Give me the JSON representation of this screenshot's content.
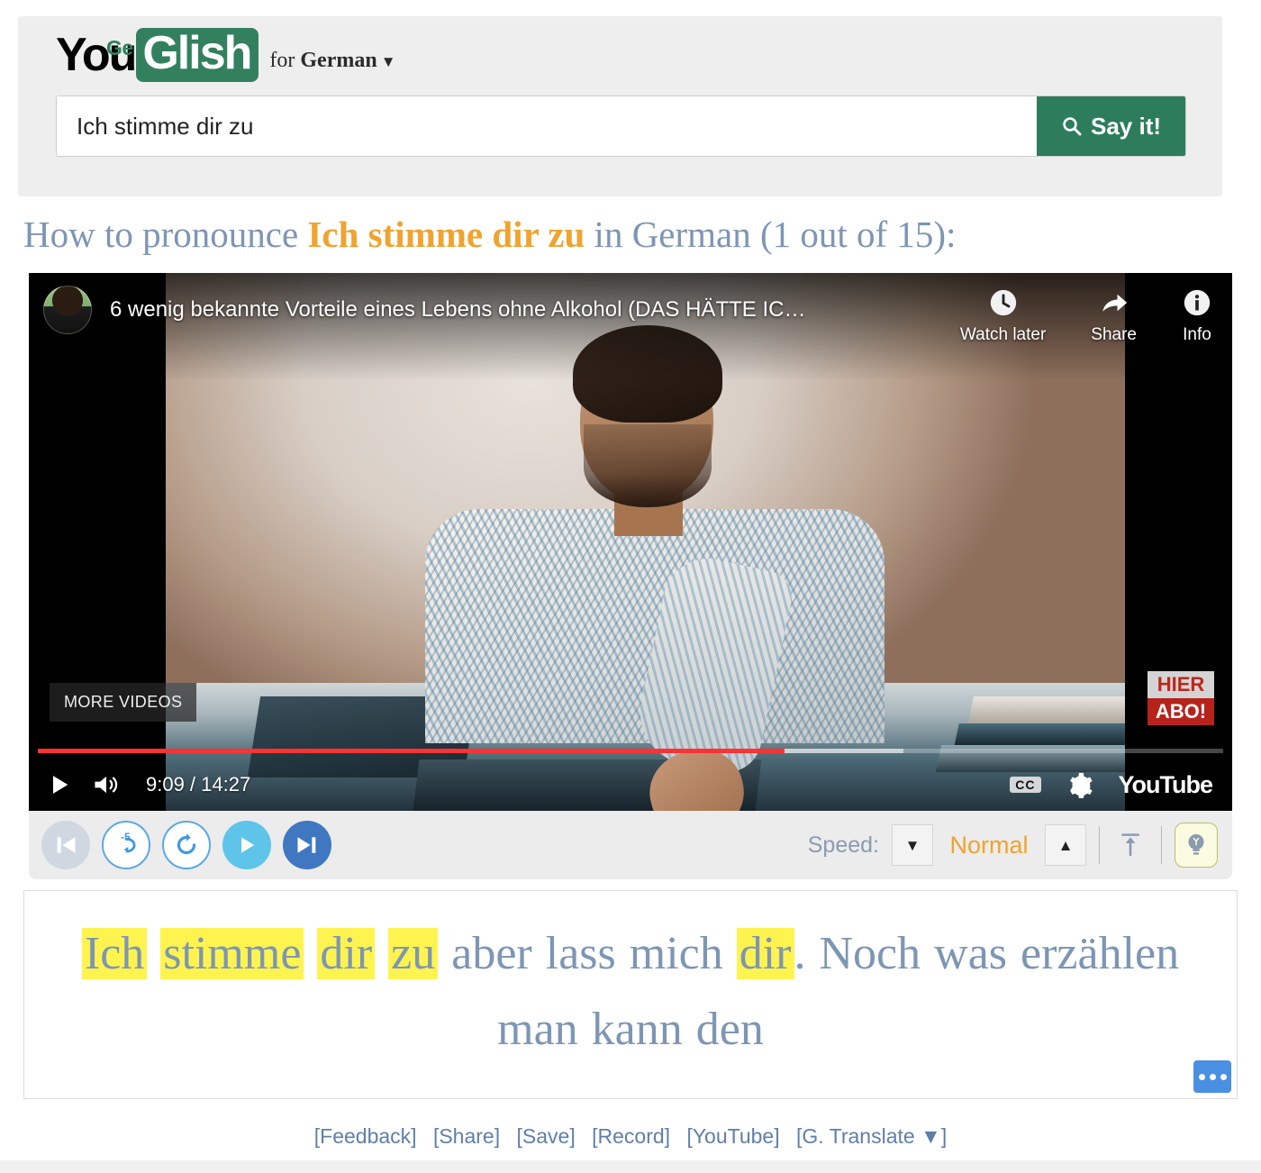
{
  "brand": {
    "logo_you": "You",
    "logo_ge": "Ge",
    "logo_glish": "Glish",
    "for_prefix": "for ",
    "language": "German",
    "language_caret": "▼"
  },
  "search": {
    "value": "Ich stimme dir zu",
    "placeholder": "Ich stimme dir zu",
    "button_label": "Say it!",
    "icon": "search-icon"
  },
  "headline": {
    "prefix": "How to pronounce ",
    "term": "Ich stimme dir zu",
    "suffix": " in German (1 out of 15):"
  },
  "player": {
    "video_title": "6 wenig bekannte Vorteile eines Lebens ohne Alkohol (DAS HÄTTE IC…",
    "avatar": "channel-avatar",
    "actions": [
      {
        "label": "Watch later",
        "icon": "clock-icon"
      },
      {
        "label": "Share",
        "icon": "share-arrow-icon"
      },
      {
        "label": "Info",
        "icon": "info-icon"
      }
    ],
    "more_videos_label": "MORE VIDEOS",
    "abo_badge_top": "HIER",
    "abo_badge_bottom": "ABO!",
    "current_time": "9:09",
    "total_time": "14:27",
    "time_display": "9:09 / 14:27",
    "progress_percent": 63,
    "buffered_percent": 73,
    "cc_label": "CC",
    "youtube_label": "YouTube",
    "play_icon": "play-icon",
    "volume_icon": "volume-icon",
    "settings_icon": "gear-icon"
  },
  "controls": {
    "buttons": [
      {
        "name": "previous-occurrence",
        "icon": "skip-previous-icon",
        "state": "disabled"
      },
      {
        "name": "rewind-5-seconds",
        "icon": "replay-5-icon",
        "label": "-5"
      },
      {
        "name": "replay-occurrence",
        "icon": "replay-icon"
      },
      {
        "name": "play-pause",
        "icon": "play-icon"
      },
      {
        "name": "next-occurrence",
        "icon": "skip-next-icon"
      }
    ],
    "speed_label": "Speed:",
    "speed_value": "Normal",
    "speed_down_icon": "caret-down-icon",
    "speed_up_icon": "caret-up-icon",
    "scroll_top_icon": "scroll-to-top-icon",
    "hint_icon": "lightbulb-icon"
  },
  "transcript": {
    "tokens": [
      {
        "text": "Ich",
        "highlight": true
      },
      {
        "text": "stimme",
        "highlight": true
      },
      {
        "text": "dir",
        "highlight": true
      },
      {
        "text": "zu",
        "highlight": true
      },
      {
        "text": "aber",
        "highlight": false
      },
      {
        "text": "lass",
        "highlight": false
      },
      {
        "text": "mich",
        "highlight": false
      },
      {
        "text": "dir",
        "highlight": true
      },
      {
        "text": ". Noch",
        "highlight": false
      },
      {
        "text": "was",
        "highlight": false
      },
      {
        "text": "erzählen",
        "highlight": false
      },
      {
        "text": "man",
        "highlight": false
      },
      {
        "text": "kann",
        "highlight": false
      },
      {
        "text": "den",
        "highlight": false
      }
    ],
    "line1": "Ich stimme dir zu aber lass mich dir. Noch",
    "line2": "was erzählen man kann den",
    "more_button_icon": "ellipsis-icon"
  },
  "footer": {
    "links": [
      "[Feedback]",
      "[Share]",
      "[Save]",
      "[Record]",
      "[YouTube]",
      "[G. Translate  ▼]"
    ]
  },
  "colors": {
    "brand_green": "#33805f",
    "accent_orange": "#f0a32e",
    "heading_blue": "#7d96b4",
    "highlight_yellow": "#fff44f",
    "progress_red": "#ff3333",
    "link_blue": "#5f7fa8"
  }
}
